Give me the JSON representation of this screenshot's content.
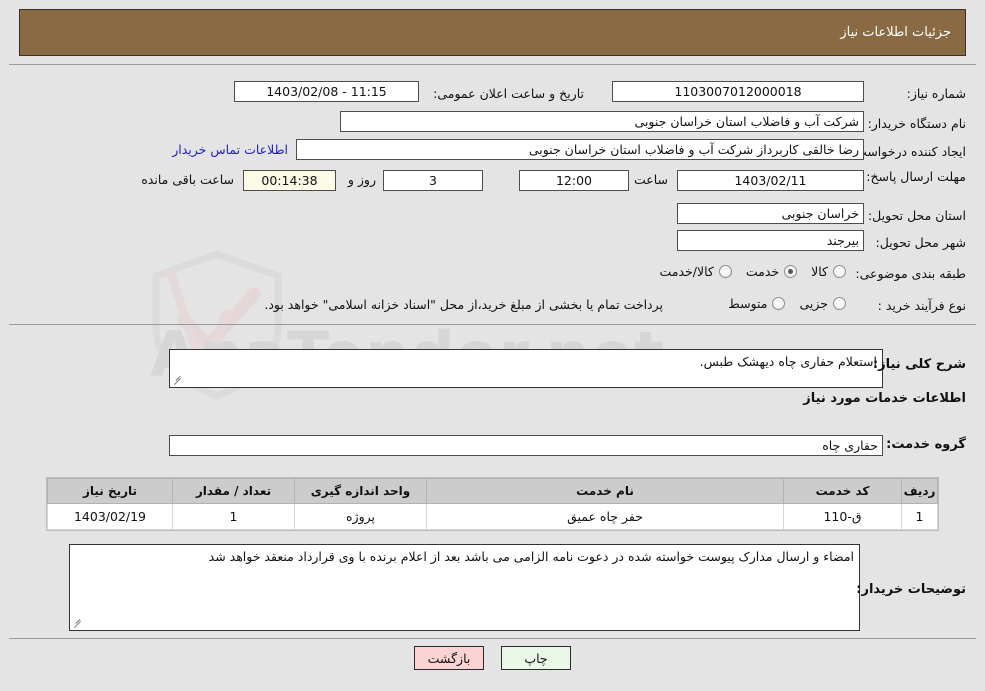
{
  "header": {
    "title": "جزئیات اطلاعات نیاز"
  },
  "form": {
    "need_number_label": "شماره نیاز:",
    "need_number_value": "1103007012000018",
    "announce_label": "تاریخ و ساعت اعلان عمومی:",
    "announce_value": "1403/02/08 - 11:15",
    "buyer_org_label": "نام دستگاه خریدار:",
    "buyer_org_value": "شرکت آب و فاضلاب استان خراسان جنوبی",
    "creator_label": "ایجاد کننده درخواست:",
    "creator_value": "رضا خالقی کاربرداز شرکت آب و فاضلاب استان خراسان جنوبی",
    "contact_link": "اطلاعات تماس خریدار",
    "deadline_label": "مهلت ارسال پاسخ: تا تاریخ:",
    "deadline_date": "1403/02/11",
    "time_label": "ساعت",
    "deadline_time": "12:00",
    "days_value": "3",
    "days_label": "روز و",
    "countdown_value": "00:14:38",
    "countdown_label": "ساعت باقی مانده",
    "province_label": "استان محل تحویل:",
    "province_value": "خراسان جنوبی",
    "city_label": "شهر محل تحویل:",
    "city_value": "بیرجند",
    "category_label": "طبقه بندی موضوعی:",
    "category_options": [
      "کالا",
      "خدمت",
      "کالا/خدمت"
    ],
    "category_selected": "خدمت",
    "process_label": "نوع فرآیند خرید :",
    "process_options": [
      "جزیی",
      "متوسط"
    ],
    "process_selected": "",
    "process_note": "پرداخت تمام یا بخشی از مبلغ خرید،از محل \"اسناد خزانه اسلامی\" خواهد بود."
  },
  "summary": {
    "label": "شرح کلی نیاز:",
    "value": "استعلام حفاری چاه دیهشک طبس."
  },
  "services_section": {
    "heading": "اطلاعات خدمات مورد نیاز",
    "group_label": "گروه خدمت:",
    "group_value": "حفاری چاه"
  },
  "table": {
    "headers": [
      "ردیف",
      "کد خدمت",
      "نام خدمت",
      "واحد اندازه گیری",
      "تعداد / مقدار",
      "تاریخ نیاز"
    ],
    "rows": [
      {
        "index": "1",
        "code": "ق-110",
        "name": "حفر چاه عمیق",
        "unit": "پروژه",
        "qty": "1",
        "date": "1403/02/19"
      }
    ]
  },
  "buyer_notes": {
    "label": "توضیحات خریدار:",
    "value": "امضاء و ارسال مدارک پیوست خواسته شده در دعوت نامه الزامی می باشد بعد از اعلام برنده با وی قرارداد منعقد خواهد شد"
  },
  "buttons": {
    "print": "چاپ",
    "back": "بازگشت"
  },
  "watermark": {
    "text": "AnaTender.net"
  },
  "colors": {
    "header_bg": "#8a6a42",
    "link": "#2020c8",
    "timer_bg": "#fbfbe6",
    "print_btn": "#e9f7e9",
    "back_btn": "#fbd3d3"
  }
}
